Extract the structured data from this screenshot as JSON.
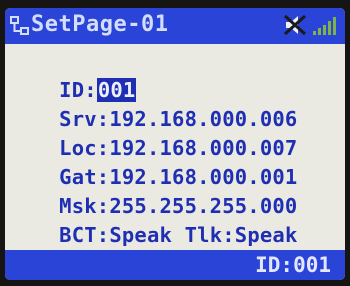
{
  "header": {
    "title": "SetPage-01",
    "icons": [
      "network-icon",
      "mute-icon",
      "signal-strength-icon"
    ]
  },
  "fields": {
    "id": {
      "label": "ID:",
      "value": "001"
    },
    "srv": {
      "label": "Srv:",
      "value": "192.168.000.006"
    },
    "loc": {
      "label": "Loc:",
      "value": "192.168.000.007"
    },
    "gat": {
      "label": "Gat:",
      "value": "192.168.000.001"
    },
    "msk": {
      "label": "Msk:",
      "value": "255.255.255.000"
    },
    "bct": {
      "label": "BCT:",
      "value": "Speak"
    },
    "tlk": {
      "label": "Tlk:",
      "value": "Speak"
    }
  },
  "status": {
    "text": "ID:001"
  },
  "colors": {
    "bezel": "#161514",
    "screen_bg": "#ebeae2",
    "bar_bg": "#2a44d8",
    "text": "#1f2fb4",
    "selection_bg": "#1f2fb4"
  }
}
